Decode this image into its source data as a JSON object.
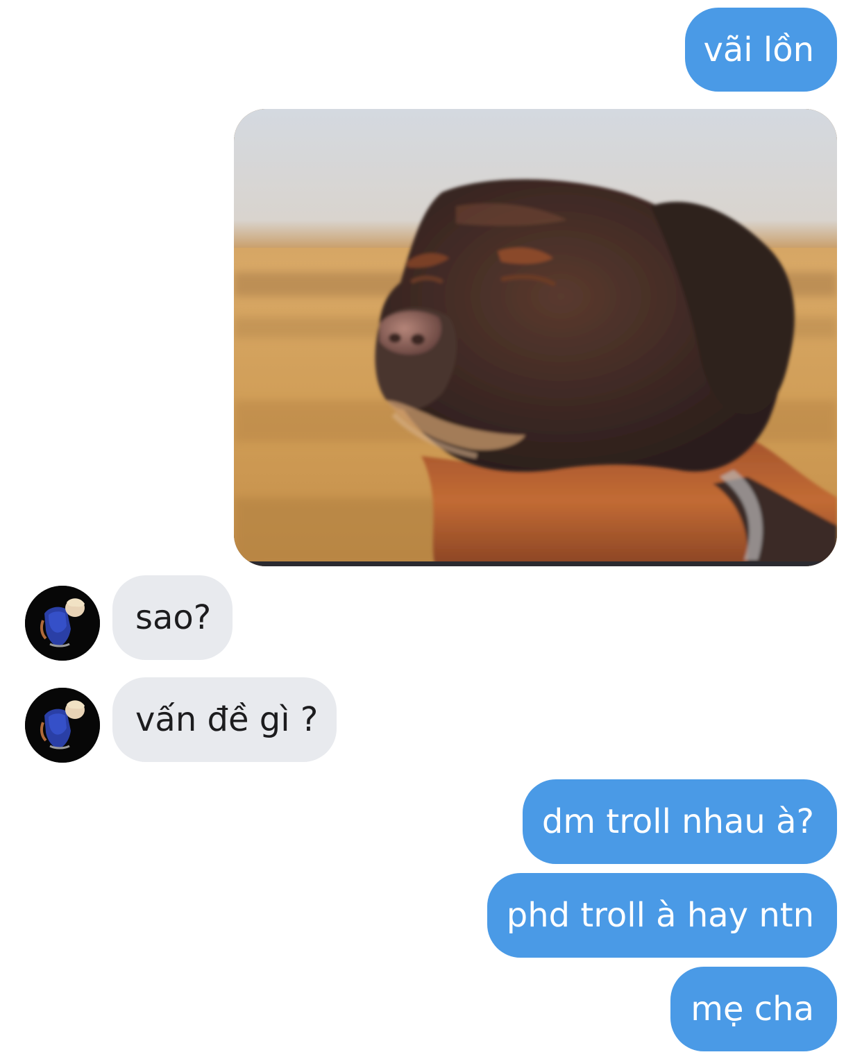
{
  "conversation": {
    "messages": [
      {
        "sender": "self",
        "type": "text",
        "text": "vãi lồn"
      },
      {
        "sender": "self",
        "type": "image",
        "icon": "dog-photo"
      },
      {
        "sender": "other",
        "type": "text",
        "text": "sao?"
      },
      {
        "sender": "other",
        "type": "text",
        "text": "vấn đề gì ?"
      },
      {
        "sender": "self",
        "type": "text",
        "text": "dm troll nhau à?"
      },
      {
        "sender": "self",
        "type": "text",
        "text": "phd troll à hay ntn"
      },
      {
        "sender": "self",
        "type": "text",
        "text": "mẹ cha"
      }
    ]
  },
  "colors": {
    "outgoing_bubble": "#4a9ae6",
    "incoming_bubble": "#e8eaee",
    "outgoing_text": "#ffffff",
    "incoming_text": "#1c1c1e"
  }
}
